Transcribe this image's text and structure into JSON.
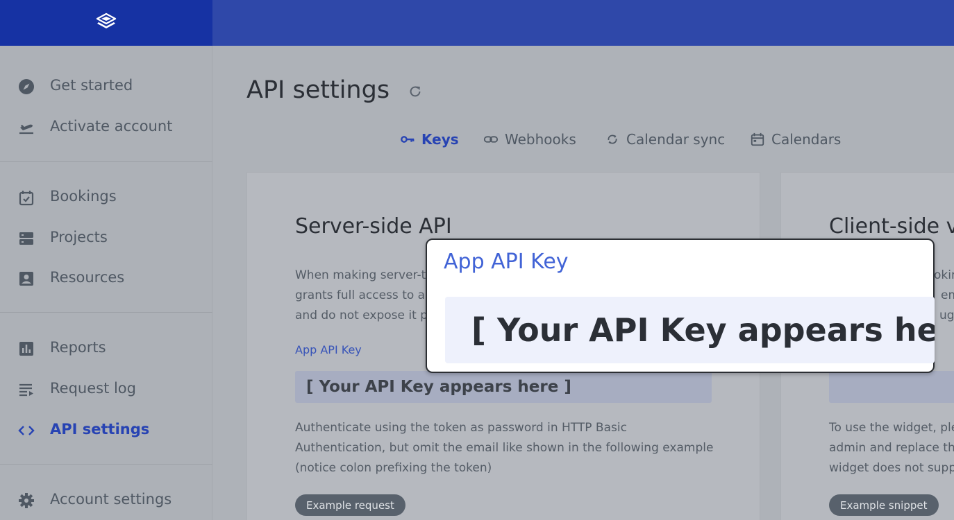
{
  "sidebar": {
    "items": [
      {
        "label": "Get started",
        "icon": "compass-icon"
      },
      {
        "label": "Activate account",
        "icon": "takeoff-icon"
      },
      {
        "label": "Bookings",
        "icon": "calendar-check-icon"
      },
      {
        "label": "Projects",
        "icon": "server-icon"
      },
      {
        "label": "Resources",
        "icon": "contact-icon"
      },
      {
        "label": "Reports",
        "icon": "bar-chart-icon"
      },
      {
        "label": "Request log",
        "icon": "list-icon"
      },
      {
        "label": "API settings",
        "icon": "code-icon",
        "active": true
      },
      {
        "label": "Account settings",
        "icon": "gear-icon"
      }
    ]
  },
  "main": {
    "title": "API settings",
    "tabs": [
      {
        "label": "Keys",
        "icon": "key-icon",
        "active": true
      },
      {
        "label": "Webhooks",
        "icon": "link-icon"
      },
      {
        "label": "Calendar sync",
        "icon": "sync-icon"
      },
      {
        "label": "Calendars",
        "icon": "calendar-icon"
      }
    ],
    "server_card": {
      "title": "Server-side API",
      "intro_lines": [
        "When making server-t",
        "grants full access to al",
        "and do not expose it p"
      ],
      "key_label": "App API Key",
      "key_value": "[ Your API Key appears here ]",
      "auth_lines": [
        "Authenticate using the token as password in HTTP Basic",
        "Authentication, but omit the email like shown in the following example",
        "(notice colon prefixing the token)"
      ],
      "button": "Example request"
    },
    "client_card": {
      "title": "Client-side v",
      "intro_lines": [
        "oking",
        "em",
        "ugh"
      ],
      "key_value": "",
      "text_lines": [
        "To use the widget, ple",
        "admin and replace th",
        "widget does not supp"
      ],
      "button": "Example snippet"
    }
  },
  "callout": {
    "label": "App API Key",
    "value": "[ Your API Key appears here ]"
  },
  "colors": {
    "brand": "#2f48a9",
    "brand_dark": "#1632a3",
    "active": "#2743b3",
    "link": "#3753b8"
  }
}
